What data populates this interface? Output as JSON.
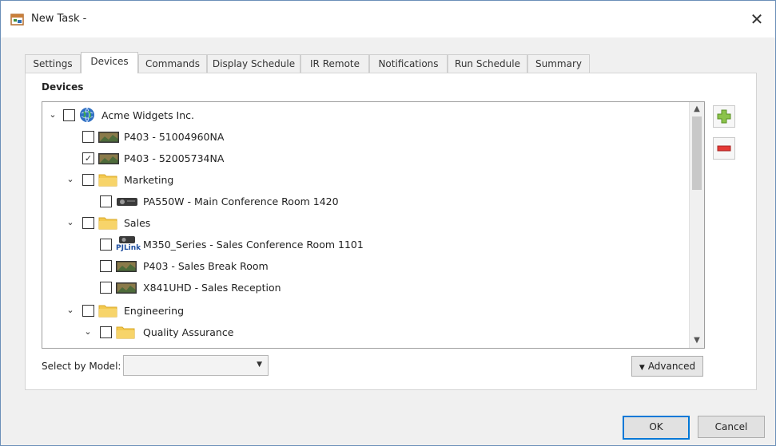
{
  "window": {
    "title": "New Task -",
    "close_glyph": "✕"
  },
  "tabs": [
    {
      "label": "Settings",
      "active": false
    },
    {
      "label": "Devices",
      "active": true
    },
    {
      "label": "Commands",
      "active": false
    },
    {
      "label": "Display Schedule",
      "active": false
    },
    {
      "label": "IR Remote",
      "active": false
    },
    {
      "label": "Notifications",
      "active": false
    },
    {
      "label": "Run Schedule",
      "active": false
    },
    {
      "label": "Summary",
      "active": false
    }
  ],
  "devices_group": {
    "label": "Devices"
  },
  "tree": [
    {
      "label": "Acme Widgets Inc.",
      "depth": 0,
      "expanded": true,
      "checked": false,
      "icon": "globe-icon"
    },
    {
      "label": "P403 - 51004960NA",
      "depth": 1,
      "expanded": null,
      "checked": false,
      "icon": "display-icon"
    },
    {
      "label": "P403 - 52005734NA",
      "depth": 1,
      "expanded": null,
      "checked": true,
      "icon": "display-icon"
    },
    {
      "label": "Marketing",
      "depth": 1,
      "expanded": true,
      "checked": false,
      "icon": "folder-icon"
    },
    {
      "label": "PA550W - Main Conference Room 1420",
      "depth": 2,
      "expanded": null,
      "checked": false,
      "icon": "projector-icon"
    },
    {
      "label": "Sales",
      "depth": 1,
      "expanded": true,
      "checked": false,
      "icon": "folder-icon"
    },
    {
      "label": "M350_Series - Sales Conference Room 1101",
      "depth": 2,
      "expanded": null,
      "checked": false,
      "icon": "pjlink-icon",
      "icon_text": "PJLink"
    },
    {
      "label": "P403 - Sales Break Room",
      "depth": 2,
      "expanded": null,
      "checked": false,
      "icon": "display-icon"
    },
    {
      "label": "X841UHD - Sales Reception",
      "depth": 2,
      "expanded": null,
      "checked": false,
      "icon": "display-icon"
    },
    {
      "label": "Engineering",
      "depth": 1,
      "expanded": true,
      "checked": false,
      "icon": "folder-icon"
    },
    {
      "label": "Quality Assurance",
      "depth": 2,
      "expanded": true,
      "checked": false,
      "icon": "folder-icon"
    }
  ],
  "tree_glyphs": {
    "expanded": "⌄",
    "checked": "✓",
    "scroll_up": "▲",
    "scroll_down": "▼"
  },
  "side_buttons": {
    "add_icon": "plus-icon",
    "remove_icon": "minus-icon",
    "add_color": "#8bc34a",
    "remove_color": "#e53935"
  },
  "model_select": {
    "label": "Select by Model:",
    "value": "",
    "arrow": "▼"
  },
  "advanced_button": {
    "label": "Advanced",
    "arrow": "▼"
  },
  "footer": {
    "ok_label": "OK",
    "cancel_label": "Cancel"
  },
  "colors": {
    "accent": "#0078d7",
    "folder": "#f3c94f"
  }
}
